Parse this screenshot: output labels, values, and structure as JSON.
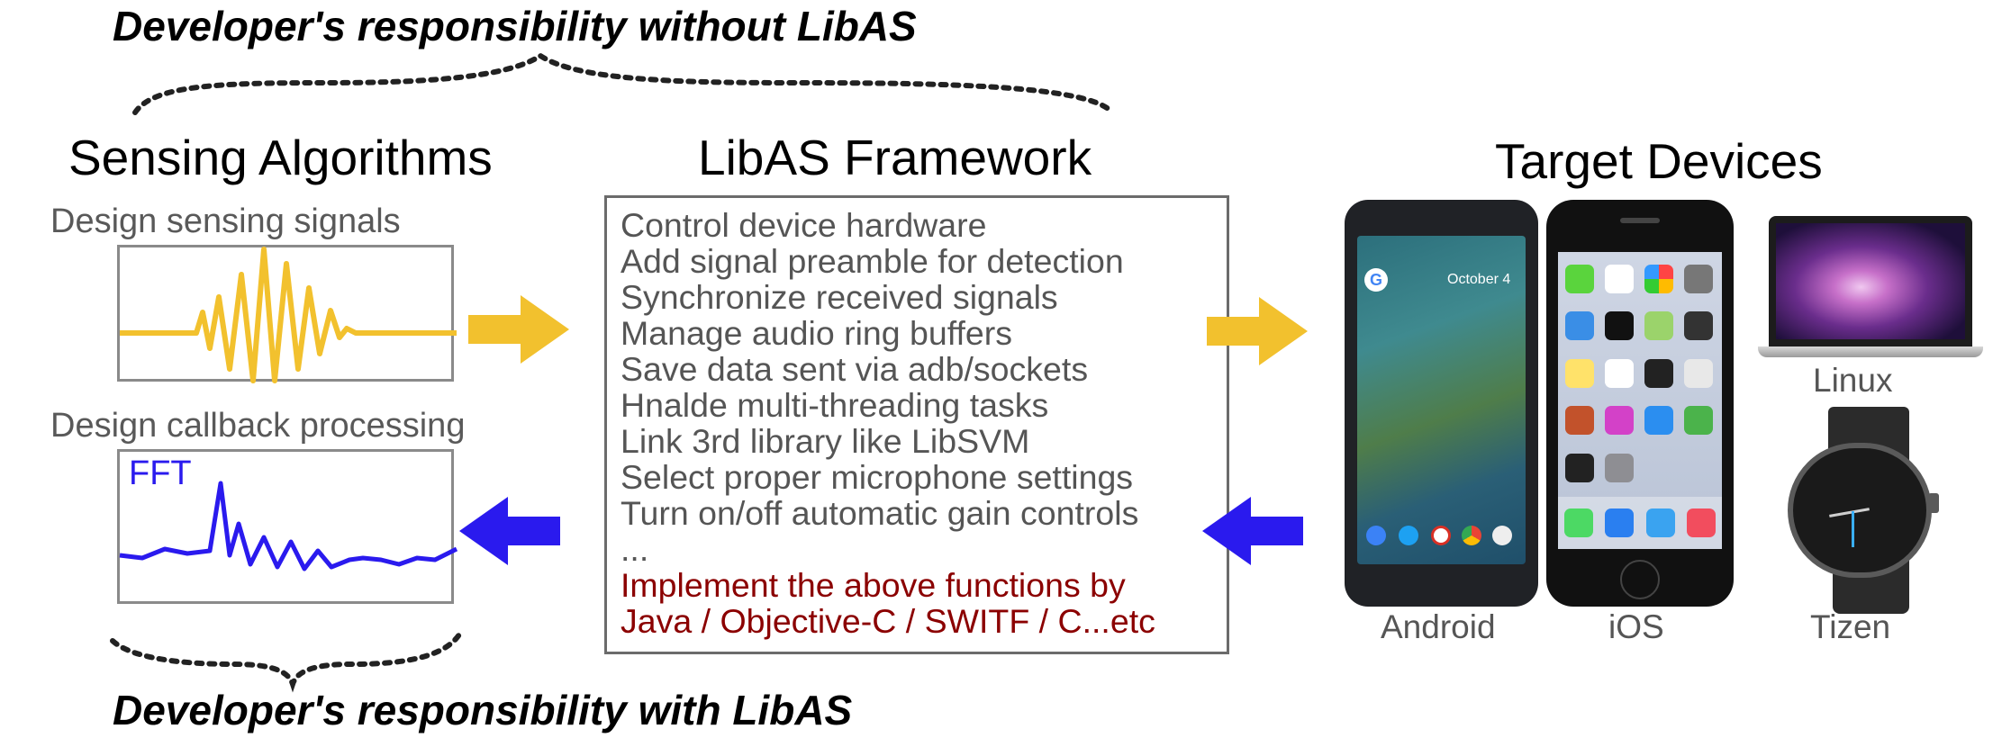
{
  "captions": {
    "top": "Developer's responsibility without LibAS",
    "bottom": "Developer's responsibility with LibAS"
  },
  "sections": {
    "sensing": {
      "title": "Sensing Algorithms",
      "signal_label": "Design sensing signals",
      "callback_label": "Design callback processing",
      "fft_label": "FFT"
    },
    "framework": {
      "title": "LibAS Framework",
      "tasks": [
        "Control device hardware",
        "Add signal preamble for detection",
        "Synchronize received signals",
        "Manage audio ring buffers",
        "Save data sent via adb/sockets",
        "Hnalde multi-threading tasks",
        "Link 3rd library like LibSVM",
        "Select proper microphone settings",
        "Turn on/off automatic gain controls",
        "..."
      ],
      "implementation": [
        "Implement the above functions by",
        "Java / Objective-C / SWITF / C...etc"
      ]
    },
    "devices": {
      "title": "Target Devices",
      "labels": [
        "Android",
        "iOS",
        "Linux",
        "Tizen"
      ],
      "android_date": "October 4"
    }
  },
  "colors": {
    "signal": "#f2c12e",
    "callback": "#2a1aee",
    "implementation_text": "#8b0000",
    "arrow_forward": "#f2c12e",
    "arrow_back": "#2a1aee"
  }
}
